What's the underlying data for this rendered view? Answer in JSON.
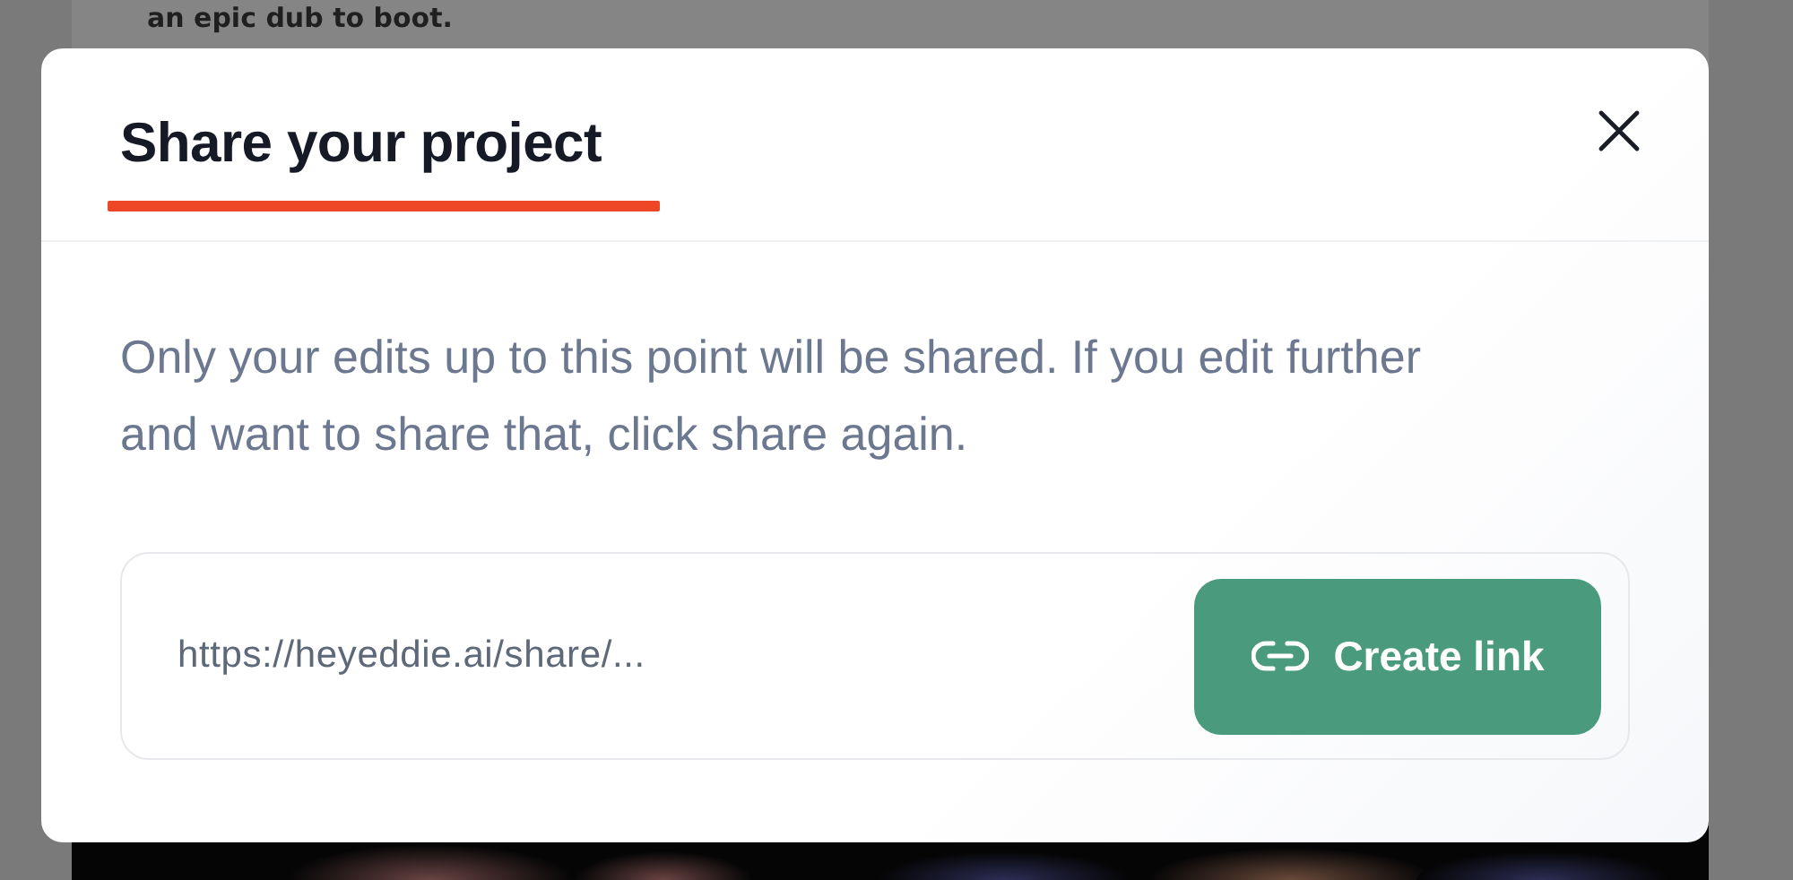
{
  "background": {
    "caption": "an epic dub to boot."
  },
  "dialog": {
    "title": "Share your project",
    "message": "Only your edits up to this point will be shared. If you edit further and want to share that, click share again.",
    "link_field": {
      "value": "https://heyeddie.ai/share/..."
    },
    "create_button": {
      "label": "Create link"
    }
  }
}
